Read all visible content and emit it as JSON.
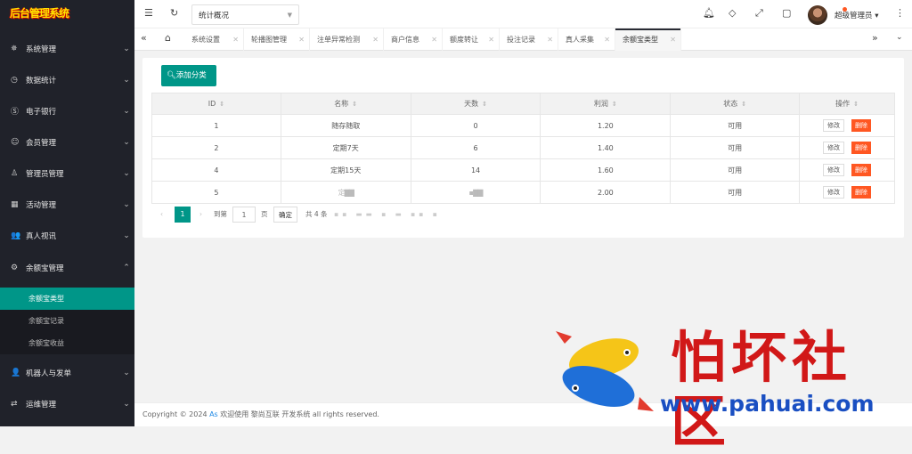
{
  "logo": "后台管理系统",
  "sidebar": [
    {
      "icon": "✵",
      "label": "系统管理",
      "arrow": "⌄"
    },
    {
      "icon": "◷",
      "label": "数据统计",
      "arrow": "⌄"
    },
    {
      "icon": "Ⓢ",
      "label": "电子银行",
      "arrow": "⌄"
    },
    {
      "icon": "☺",
      "label": "会员管理",
      "arrow": "⌄"
    },
    {
      "icon": "♙",
      "label": "管理员管理",
      "arrow": "⌄"
    },
    {
      "icon": "▦",
      "label": "活动管理",
      "arrow": "⌄"
    },
    {
      "icon": "👥",
      "label": "真人视讯",
      "arrow": "⌄"
    },
    {
      "icon": "⚙",
      "label": "余额宝管理",
      "arrow": "⌃"
    },
    {
      "icon": "👤",
      "label": "机器人与发单",
      "arrow": "⌄"
    },
    {
      "icon": "⇄",
      "label": "运维管理",
      "arrow": "⌄"
    }
  ],
  "submenu": [
    "余额宝类型",
    "余额宝记录",
    "余额宝收益"
  ],
  "topbar": {
    "select_value": "统计概况",
    "user": "超级管理员 ▾"
  },
  "tabs": [
    "系统设置",
    "轮播图管理",
    "注单异常检测",
    "商户信息",
    "额度转让",
    "投注记录",
    "真人采集",
    "余额宝类型"
  ],
  "content": {
    "add_button": "添加分类",
    "columns": [
      "ID",
      "名称",
      "天数",
      "利润",
      "状态",
      "操作"
    ],
    "rows": [
      {
        "id": "1",
        "name": "随存随取",
        "days": "0",
        "profit": "1.20",
        "status": "可用"
      },
      {
        "id": "2",
        "name": "定期7天",
        "days": "6",
        "profit": "1.40",
        "status": "可用"
      },
      {
        "id": "4",
        "name": "定期15天",
        "days": "14",
        "profit": "1.60",
        "status": "可用"
      },
      {
        "id": "5",
        "name": "定▇▇",
        "days": "▪▇▇",
        "profit": "2.00",
        "status": "可用"
      }
    ],
    "edit_label": "修改",
    "delete_label": "删除",
    "pager": {
      "current": "1",
      "goto_label": "到第",
      "goto_value": "1",
      "page_unit": "页",
      "confirm": "确定",
      "total": "共 4 条"
    }
  },
  "footer": {
    "prefix": "Copyright © 2024 ",
    "link": "As",
    "suffix": " 欢迎使用 黎尚互联 开发系统 all rights reserved."
  },
  "watermark": {
    "title": "怕坏社区",
    "url": "www.pahuai.com"
  },
  "colors": {
    "sidebar": "#20222a",
    "accent": "#009688",
    "danger": "#ff5722",
    "tab_active": "#292b34"
  }
}
